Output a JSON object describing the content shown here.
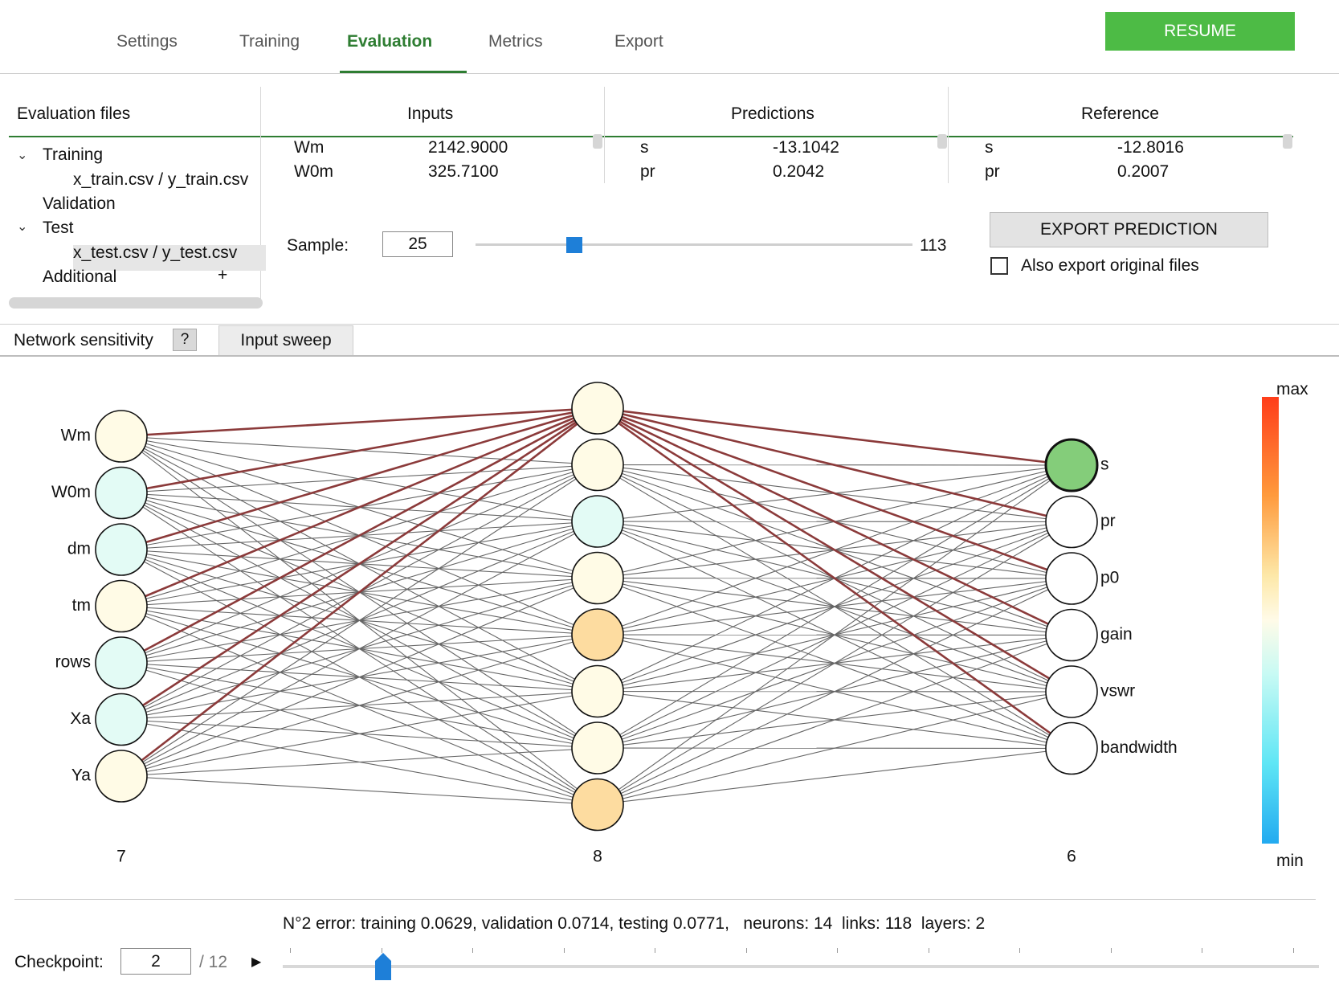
{
  "tabs": {
    "settings": "Settings",
    "training": "Training",
    "evaluation": "Evaluation",
    "metrics": "Metrics",
    "export": "Export",
    "active": "Evaluation"
  },
  "resume_label": "RESUME",
  "files_panel": {
    "header": "Evaluation files",
    "training": "Training",
    "training_file": "x_train.csv / y_train.csv",
    "validation": "Validation",
    "test": "Test",
    "test_file": "x_test.csv / y_test.csv",
    "additional": "Additional",
    "add_symbol": "+"
  },
  "inputs_panel": {
    "header": "Inputs",
    "rows": [
      {
        "name": "Wm",
        "value": "2142.9000"
      },
      {
        "name": "W0m",
        "value": "325.7100"
      }
    ]
  },
  "predictions_panel": {
    "header": "Predictions",
    "rows": [
      {
        "name": "s",
        "value": "-13.1042"
      },
      {
        "name": "pr",
        "value": "0.2042"
      }
    ]
  },
  "reference_panel": {
    "header": "Reference",
    "rows": [
      {
        "name": "s",
        "value": "-12.8016"
      },
      {
        "name": "pr",
        "value": "0.2007"
      }
    ]
  },
  "sample": {
    "label": "Sample:",
    "value": "25",
    "max": "113"
  },
  "export": {
    "button": "EXPORT PREDICTION",
    "checkbox_label": "Also export original files",
    "checked": false
  },
  "sensitivity": {
    "label": "Network sensitivity",
    "help": "?",
    "sweep_tab": "Input sweep"
  },
  "network": {
    "input_nodes": [
      {
        "label": "Wm",
        "color": "#fffbe6"
      },
      {
        "label": "W0m",
        "color": "#e3fbf5"
      },
      {
        "label": "dm",
        "color": "#e3fbf5"
      },
      {
        "label": "tm",
        "color": "#fffbe6"
      },
      {
        "label": "rows",
        "color": "#e3fbf5"
      },
      {
        "label": "Xa",
        "color": "#e3fbf5"
      },
      {
        "label": "Ya",
        "color": "#fffbe6"
      }
    ],
    "hidden_nodes": [
      {
        "color": "#fffbe6"
      },
      {
        "color": "#fffbe6"
      },
      {
        "color": "#e3fbf5"
      },
      {
        "color": "#fffbe6"
      },
      {
        "color": "#fddca0"
      },
      {
        "color": "#fffbe6"
      },
      {
        "color": "#fffbe6"
      },
      {
        "color": "#fddca0"
      }
    ],
    "output_nodes": [
      {
        "label": "s",
        "color": "#84cd7a",
        "selected": true
      },
      {
        "label": "pr",
        "color": "#ffffff"
      },
      {
        "label": "p0",
        "color": "#ffffff"
      },
      {
        "label": "gain",
        "color": "#ffffff"
      },
      {
        "label": "vswr",
        "color": "#ffffff"
      },
      {
        "label": "bandwidth",
        "color": "#ffffff"
      }
    ],
    "layer_counts": [
      "7",
      "8",
      "6"
    ],
    "highlight_color": "#8b3a3a",
    "link_color": "#666666"
  },
  "colorbar": {
    "max_label": "max",
    "min_label": "min"
  },
  "status_text": "N°2 error: training 0.0629, validation 0.0714, testing 0.0771,   neurons: 14  links: 118  layers: 2",
  "checkpoint": {
    "label": "Checkpoint:",
    "value": "2",
    "total": "/ 12",
    "play_icon": "play-icon"
  }
}
